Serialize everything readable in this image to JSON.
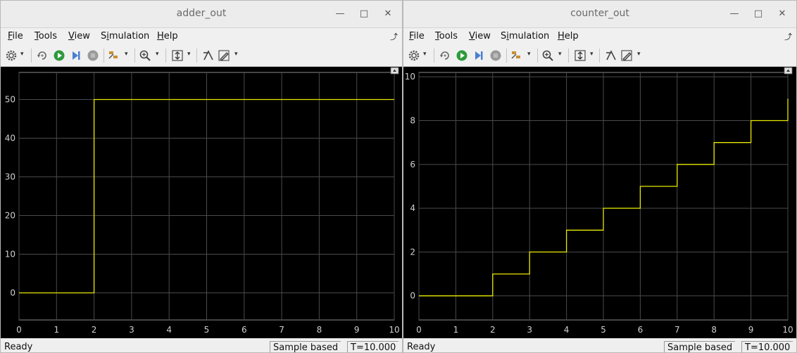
{
  "menu": {
    "file": {
      "u": "F",
      "rest": "ile"
    },
    "tools": {
      "u": "T",
      "rest": "ools"
    },
    "view": {
      "u": "V",
      "rest": "iew"
    },
    "simulation": {
      "pre": "S",
      "u": "i",
      "rest": "mulation"
    },
    "help": {
      "u": "H",
      "rest": "elp"
    }
  },
  "icons": [
    "gear-icon",
    "restore-icon",
    "run-icon",
    "step-forward-icon",
    "stop-icon",
    "highlight-icon",
    "zoom-icon",
    "autoscale-icon",
    "cursor-measure-icon",
    "edit-icon"
  ],
  "colors": {
    "trace": "#e8e800",
    "grid": "#4a4a4a",
    "plot_bg": "#000000"
  },
  "windows": [
    {
      "title": "adder_out",
      "status": {
        "ready": "Ready",
        "mode": "Sample based",
        "time": "T=10.000"
      }
    },
    {
      "title": "counter_out",
      "status": {
        "ready": "Ready",
        "mode": "Sample based",
        "time": "T=10.000"
      }
    }
  ],
  "chart_data": [
    {
      "type": "line",
      "step": true,
      "xlim": [
        0,
        10
      ],
      "ylim": [
        -7,
        57
      ],
      "xticks": [
        0,
        1,
        2,
        3,
        4,
        5,
        6,
        7,
        8,
        9,
        10
      ],
      "yticks": [
        0,
        10,
        20,
        30,
        40,
        50
      ],
      "grid": true,
      "series": [
        {
          "x": [
            0,
            2,
            2,
            10
          ],
          "y": [
            0,
            0,
            50,
            50
          ]
        }
      ]
    },
    {
      "type": "line",
      "step": true,
      "xlim": [
        0,
        10
      ],
      "ylim": [
        -1.1,
        10.2
      ],
      "xticks": [
        0,
        1,
        2,
        3,
        4,
        5,
        6,
        7,
        8,
        9,
        10
      ],
      "yticks": [
        0,
        2,
        4,
        6,
        8,
        10
      ],
      "grid": true,
      "series": [
        {
          "x": [
            0,
            2,
            2,
            3,
            3,
            4,
            4,
            5,
            5,
            6,
            6,
            7,
            7,
            8,
            8,
            9,
            9,
            10,
            10
          ],
          "y": [
            0,
            0,
            1,
            1,
            2,
            2,
            3,
            3,
            4,
            4,
            5,
            5,
            6,
            6,
            7,
            7,
            8,
            8,
            9
          ]
        }
      ]
    }
  ]
}
